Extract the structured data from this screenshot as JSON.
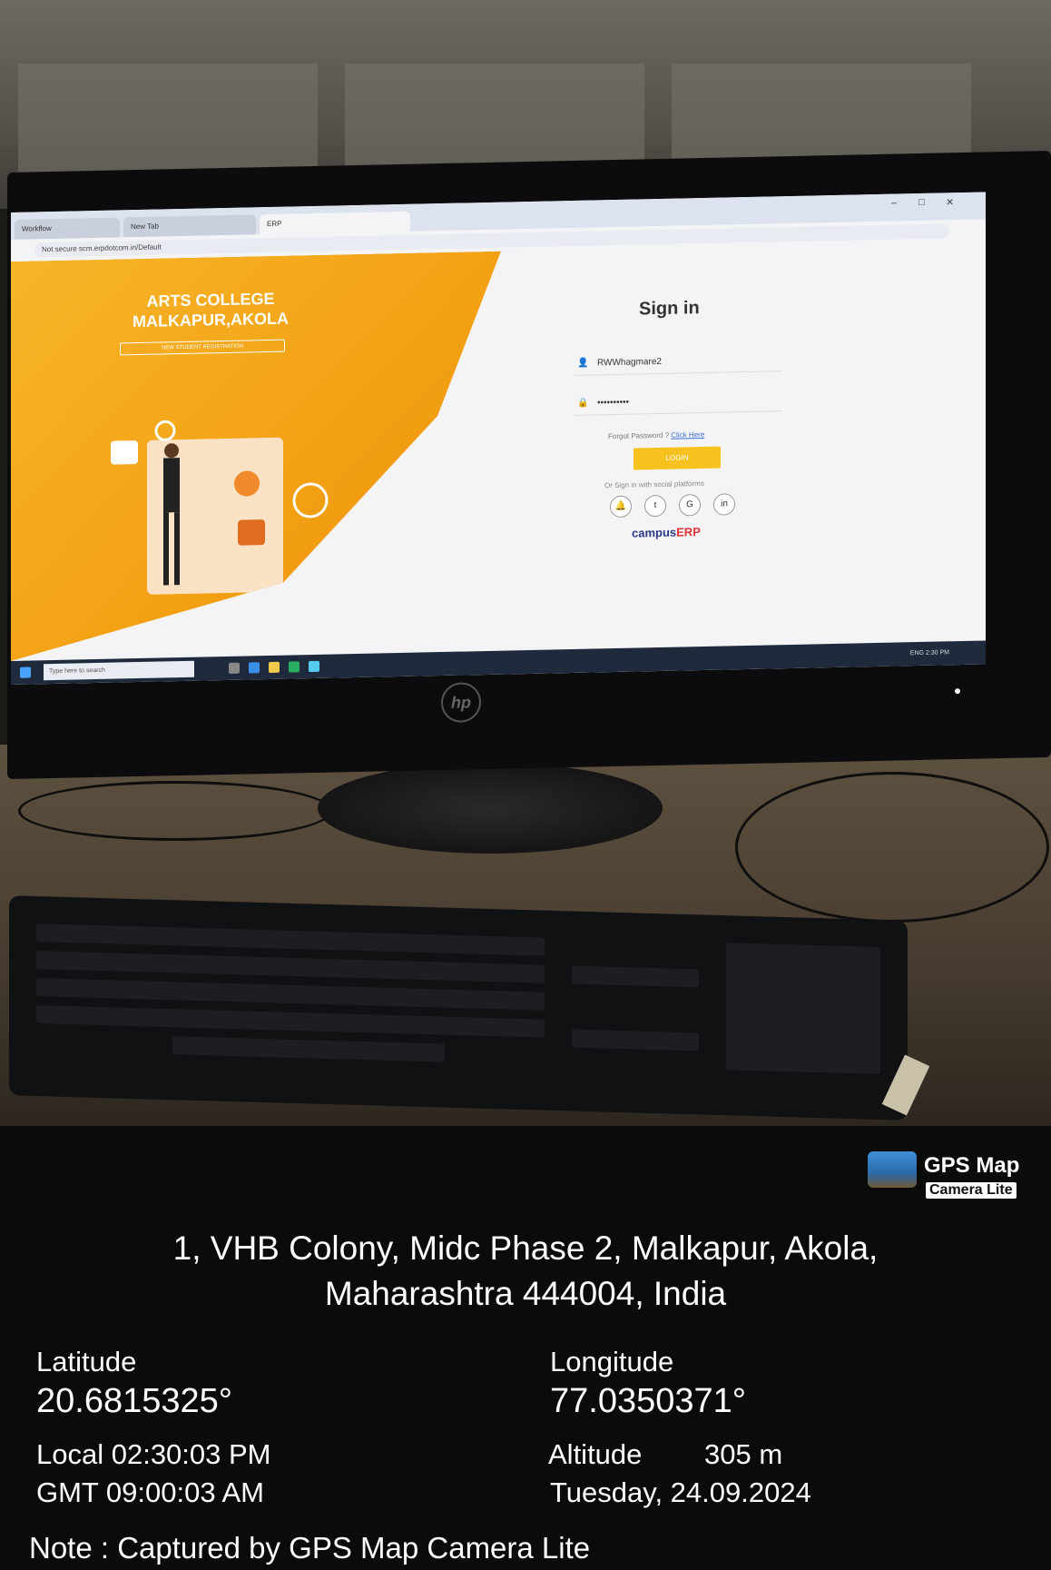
{
  "browser": {
    "tabs": [
      "Workflow",
      "New Tab",
      "ERP"
    ],
    "address": "Not secure  scm.erpdotcom.in/Default"
  },
  "login_page": {
    "college_title_line1": "ARTS COLLEGE",
    "college_title_line2": "MALKAPUR,AKOLA",
    "registration_button": "NEW STUDENT REGISTRATION",
    "signin_title": "Sign in",
    "username_value": "RWWhagmare2",
    "password_value": "••••••••••",
    "forgot_text": "Forgot Password ?",
    "forgot_link": "Click Here",
    "login_button": "LOGIN",
    "social_label": "Or Sign in with social platforms",
    "social_icons": [
      "bell-icon",
      "twitter-icon",
      "google-icon",
      "linkedin-icon"
    ],
    "erp_logo_main": "campus",
    "erp_logo_accent": "ERP"
  },
  "taskbar": {
    "search_placeholder": "Type here to search",
    "time": "2:30 PM",
    "lang": "ENG"
  },
  "monitor": {
    "brand": "hp"
  },
  "gps_overlay": {
    "app_name": "GPS Map",
    "app_sub": "Camera Lite",
    "address_line1": "1, VHB Colony, Midc Phase 2, Malkapur, Akola,",
    "address_line2": "Maharashtra 444004, India",
    "latitude_label": "Latitude",
    "latitude_value": "20.6815325°",
    "longitude_label": "Longitude",
    "longitude_value": "77.0350371°",
    "local_time": "Local 02:30:03 PM",
    "gmt_time": "GMT 09:00:03 AM",
    "altitude_label": "Altitude",
    "altitude_value": "305 m",
    "date": "Tuesday, 24.09.2024",
    "note": "Note : Captured by GPS Map Camera Lite"
  },
  "colors": {
    "hero_orange": "#f3a012",
    "login_yellow": "#f7c21e",
    "taskbar": "#1f2b3d",
    "overlay_bg": "#0a0a0a"
  }
}
